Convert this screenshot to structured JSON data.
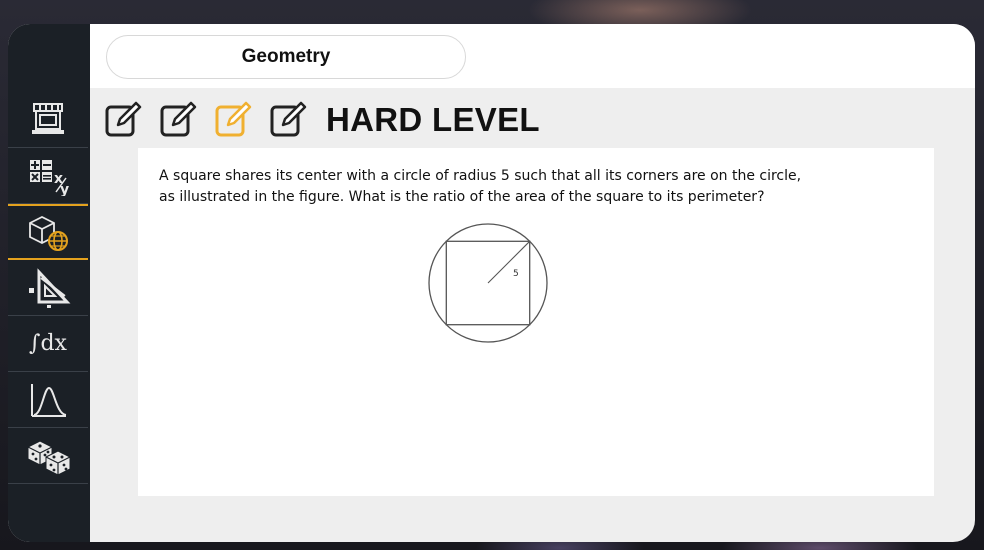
{
  "header": {
    "title": "Geometry"
  },
  "sidebar": {
    "items": [
      {
        "icon": "shop-icon",
        "active": false
      },
      {
        "icon": "arithmetic-icon",
        "active": false
      },
      {
        "icon": "geometry-icon",
        "active": true
      },
      {
        "icon": "triangle-ruler-icon",
        "active": false
      },
      {
        "icon": "integral-icon",
        "label": "∫dx",
        "active": false
      },
      {
        "icon": "distribution-curve-icon",
        "active": false
      },
      {
        "icon": "dice-icon",
        "active": false
      }
    ]
  },
  "levels": {
    "icons": [
      {
        "icon": "edit-icon",
        "color": "#222222"
      },
      {
        "icon": "edit-icon",
        "color": "#222222"
      },
      {
        "icon": "edit-icon",
        "color": "#f0b030",
        "selected": true
      },
      {
        "icon": "edit-icon",
        "color": "#222222"
      }
    ],
    "title": "HARD LEVEL"
  },
  "question": {
    "line1": "A square shares its center with a circle of radius 5 such that all its corners are on the circle,",
    "line2": "as illustrated in the figure. What is the ratio of the area of the square to its perimeter?",
    "figure_label": "5"
  },
  "colors": {
    "accent": "#e4a21e",
    "sidebar": "#1b2026",
    "page": "#eeeeee"
  }
}
